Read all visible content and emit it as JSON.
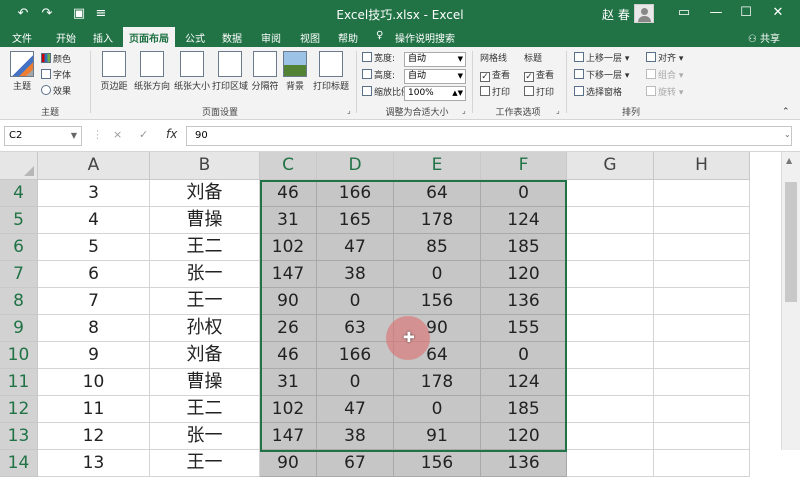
{
  "window": {
    "title": "Excel技巧.xlsx  -  Excel",
    "user": "赵 春"
  },
  "tabs": [
    "文件",
    "开始",
    "插入",
    "页面布局",
    "公式",
    "数据",
    "审阅",
    "视图",
    "帮助",
    "操作说明搜索"
  ],
  "share_label": "共享",
  "ribbon": {
    "theme": {
      "big": "主题",
      "colors": "颜色",
      "fonts": "字体",
      "effects": "效果",
      "group": "主题"
    },
    "page_setup": {
      "margins": "页边距",
      "orientation": "纸张方向",
      "size": "纸张大小",
      "print_area": "打印区域",
      "breaks": "分隔符",
      "background": "背景",
      "print_titles": "打印标题",
      "group": "页面设置"
    },
    "scale": {
      "width_label": "宽度:",
      "width_value": "自动",
      "height_label": "高度:",
      "height_value": "自动",
      "zoom_label": "缩放比例:",
      "zoom_value": "100%",
      "group": "调整为合适大小"
    },
    "sheet_options": {
      "gridlines": "网格线",
      "headings": "标题",
      "view": "查看",
      "print": "打印",
      "group": "工作表选项"
    },
    "arrange": {
      "bring_forward": "上移一层",
      "send_backward": "下移一层",
      "selection_pane": "选择窗格",
      "align": "对齐",
      "group_btn": "组合",
      "rotate": "旋转",
      "group": "排列"
    }
  },
  "formula_bar": {
    "name_box": "C2",
    "cancel": "×",
    "enter": "✓",
    "fx": "fx",
    "value": "90"
  },
  "columns": [
    "A",
    "B",
    "C",
    "D",
    "E",
    "F",
    "G",
    "H"
  ],
  "rows": [
    {
      "num": "4",
      "cells": [
        "3",
        "刘备",
        "46",
        "166",
        "64",
        "0"
      ]
    },
    {
      "num": "5",
      "cells": [
        "4",
        "曹操",
        "31",
        "165",
        "178",
        "124"
      ]
    },
    {
      "num": "6",
      "cells": [
        "5",
        "王二",
        "102",
        "47",
        "85",
        "185"
      ]
    },
    {
      "num": "7",
      "cells": [
        "6",
        "张一",
        "147",
        "38",
        "0",
        "120"
      ]
    },
    {
      "num": "8",
      "cells": [
        "7",
        "王一",
        "90",
        "0",
        "156",
        "136"
      ]
    },
    {
      "num": "9",
      "cells": [
        "8",
        "孙权",
        "26",
        "63",
        "90",
        "155"
      ]
    },
    {
      "num": "10",
      "cells": [
        "9",
        "刘备",
        "46",
        "166",
        "64",
        "0"
      ]
    },
    {
      "num": "11",
      "cells": [
        "10",
        "曹操",
        "31",
        "0",
        "178",
        "124"
      ]
    },
    {
      "num": "12",
      "cells": [
        "11",
        "王二",
        "102",
        "47",
        "0",
        "185"
      ]
    },
    {
      "num": "13",
      "cells": [
        "12",
        "张一",
        "147",
        "38",
        "91",
        "120"
      ]
    },
    {
      "num": "14",
      "cells": [
        "13",
        "王一",
        "90",
        "67",
        "156",
        "136"
      ]
    }
  ]
}
